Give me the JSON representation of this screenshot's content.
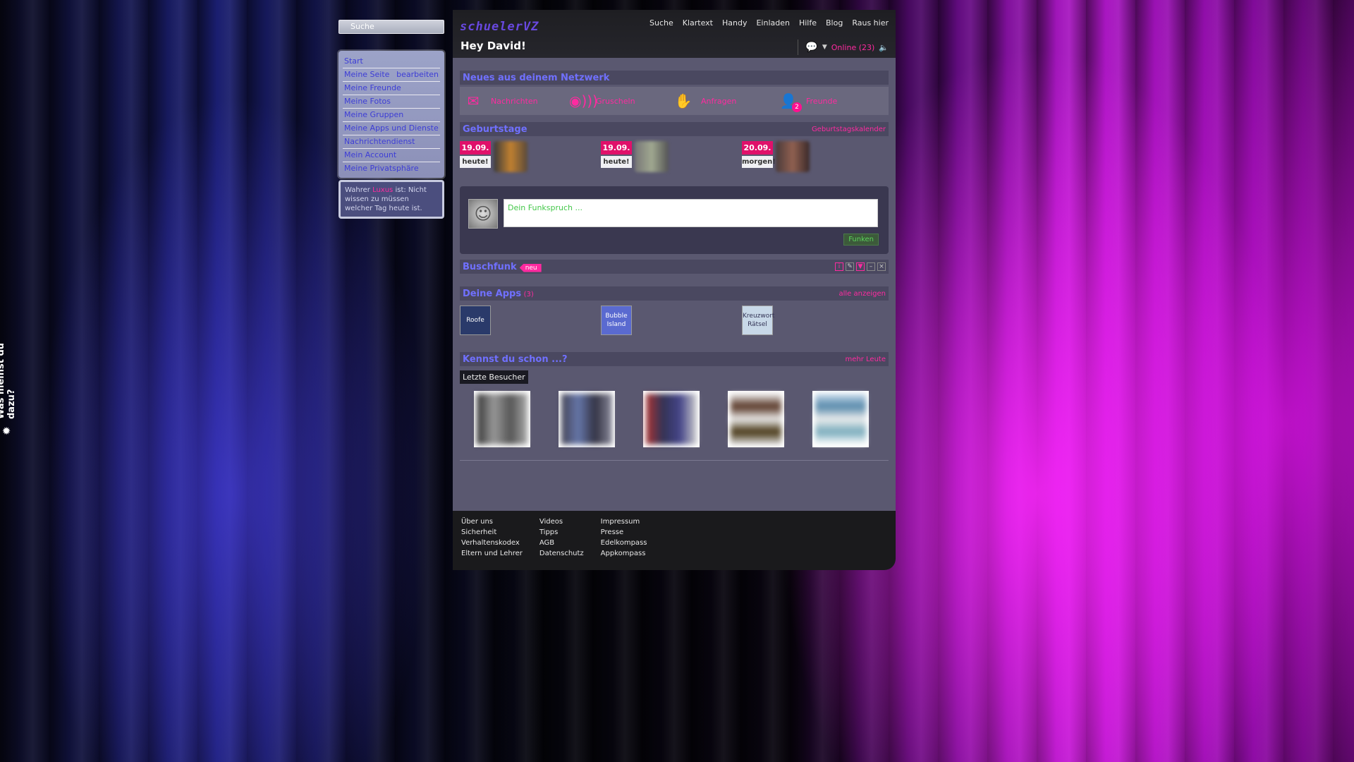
{
  "side_tab": {
    "label": "Was meinst du dazu?"
  },
  "search": {
    "placeholder": "Suche"
  },
  "leftnav": [
    {
      "label": "Start",
      "extra": ""
    },
    {
      "label": "Meine Seite",
      "extra": "bearbeiten"
    },
    {
      "label": "Meine Freunde",
      "extra": ""
    },
    {
      "label": "Meine Fotos",
      "extra": ""
    },
    {
      "label": "Meine Gruppen",
      "extra": ""
    },
    {
      "label": "Meine Apps und Dienste",
      "extra": ""
    },
    {
      "label": "Nachrichtendienst",
      "extra": ""
    },
    {
      "label": "Mein Account",
      "extra": ""
    },
    {
      "label": "Meine Privatsphäre",
      "extra": ""
    }
  ],
  "tip": {
    "prefix": "Wahrer",
    "suffix": "ist: Nicht wissen zu müssen welcher Tag heute ist."
  },
  "header": {
    "logo": "schuelerVZ",
    "nav": [
      "Suche",
      "Klartext",
      "Handy",
      "Einladen",
      "Hilfe",
      "Blog",
      "Raus hier"
    ],
    "greeting": "Hey David!",
    "online": "Online (23)"
  },
  "network": {
    "title": "Neues aus deinem Netzwerk",
    "items": [
      {
        "icon": "envelope-icon",
        "label": "Nachrichten"
      },
      {
        "icon": "broadcast-icon",
        "label": "Gruscheln"
      },
      {
        "icon": "request-icon",
        "label": "Anfragen"
      },
      {
        "icon": "friends-icon",
        "label": "Freunde",
        "badge": "2"
      }
    ]
  },
  "birthdays": {
    "title": "Geburtstage",
    "link": "Geburtstagskalender",
    "items": [
      {
        "date": "19.09.",
        "when": "heute!"
      },
      {
        "date": "19.09.",
        "when": "heute!"
      },
      {
        "date": "20.09.",
        "when": "morgen!"
      }
    ]
  },
  "funk": {
    "placeholder": "Dein Funkspruch ...",
    "button": "Funken"
  },
  "buschfunk": {
    "title": "Buschfunk",
    "tag": "neu"
  },
  "apps": {
    "title": "Deine Apps",
    "count": "(3)",
    "link": "alle anzeigen",
    "items": [
      {
        "icon": "roofe-icon",
        "icon_text": "Roofe",
        "name": ""
      },
      {
        "icon": "bubble-island-icon",
        "icon_text": "Bubble Island",
        "name": ""
      },
      {
        "icon": "kreuzwort-icon",
        "icon_text": "Kreuzwort Rätsel",
        "name": ""
      }
    ]
  },
  "kennst": {
    "title": "Kennst du schon ...?",
    "link": "mehr Leute",
    "active_tab": "Letzte Besucher",
    "visitor_count": 5
  },
  "footer": {
    "col1": [
      "Über uns",
      "Sicherheit",
      "Verhaltenskodex",
      "Eltern und Lehrer"
    ],
    "col2": [
      "Videos",
      "Tipps",
      "AGB",
      "Datenschutz"
    ],
    "col3": [
      "Impressum",
      "Presse",
      "Edelkompass",
      "Appkompass"
    ]
  },
  "colors": {
    "accent": "#ff2aa0",
    "link_blue": "#7070ff",
    "date_bg": "#e0106a",
    "funk_green": "#44c84a"
  }
}
